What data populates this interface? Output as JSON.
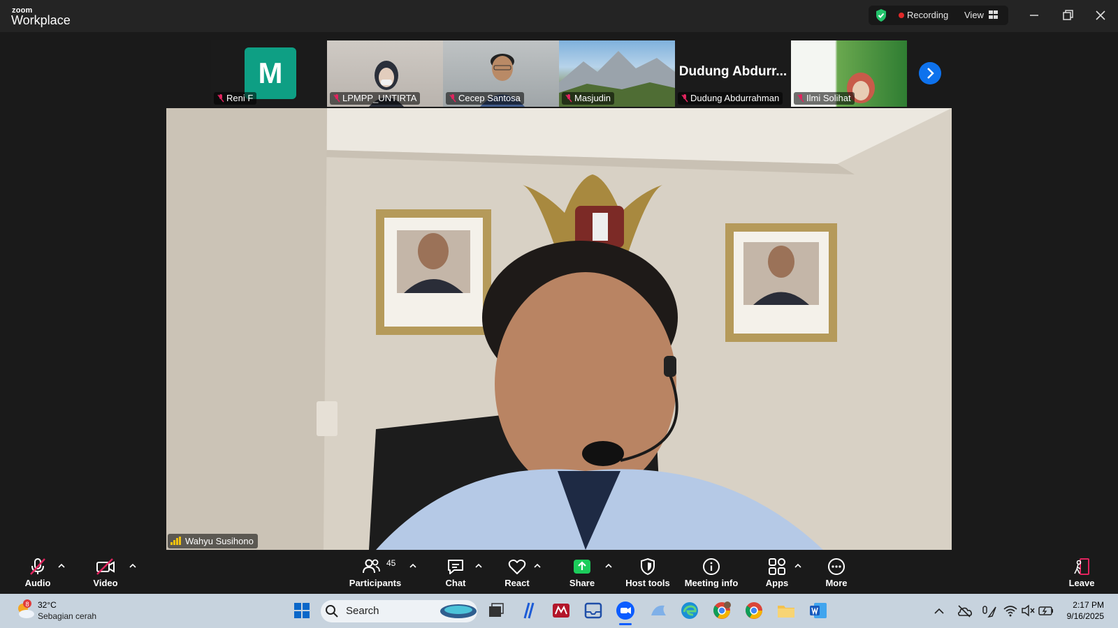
{
  "titlebar": {
    "brand_small": "zoom",
    "brand_big": "Workplace",
    "recording_label": "Recording",
    "view_label": "View"
  },
  "participants_strip": [
    {
      "name": "Reni F",
      "avatar_letter": "M",
      "avatar_color": "#0e9f84"
    },
    {
      "name": "LPMPP_UNTIRTA"
    },
    {
      "name": "Cecep Santosa"
    },
    {
      "name": "Masjudin"
    },
    {
      "name": "Dudung Abdurrahman",
      "display_big": "Dudung Abdurr..."
    },
    {
      "name": "Ilmi Solihat"
    }
  ],
  "speaker": {
    "name": "Wahyu Susihono"
  },
  "toolbar": {
    "audio": "Audio",
    "video": "Video",
    "participants": "Participants",
    "participant_count": "45",
    "chat": "Chat",
    "react": "React",
    "share": "Share",
    "host_tools": "Host tools",
    "meeting_info": "Meeting info",
    "apps": "Apps",
    "more": "More",
    "leave": "Leave"
  },
  "taskbar": {
    "weather_badge": "8",
    "temperature": "32°C",
    "weather_desc": "Sebagian cerah",
    "search_label": "Search",
    "time": "2:17 PM",
    "date": "9/16/2025"
  },
  "colors": {
    "accent_blue": "#0e72ed",
    "share_green": "#1ccc5b",
    "recording_red": "#e02828",
    "muted_red": "#e0245e"
  }
}
